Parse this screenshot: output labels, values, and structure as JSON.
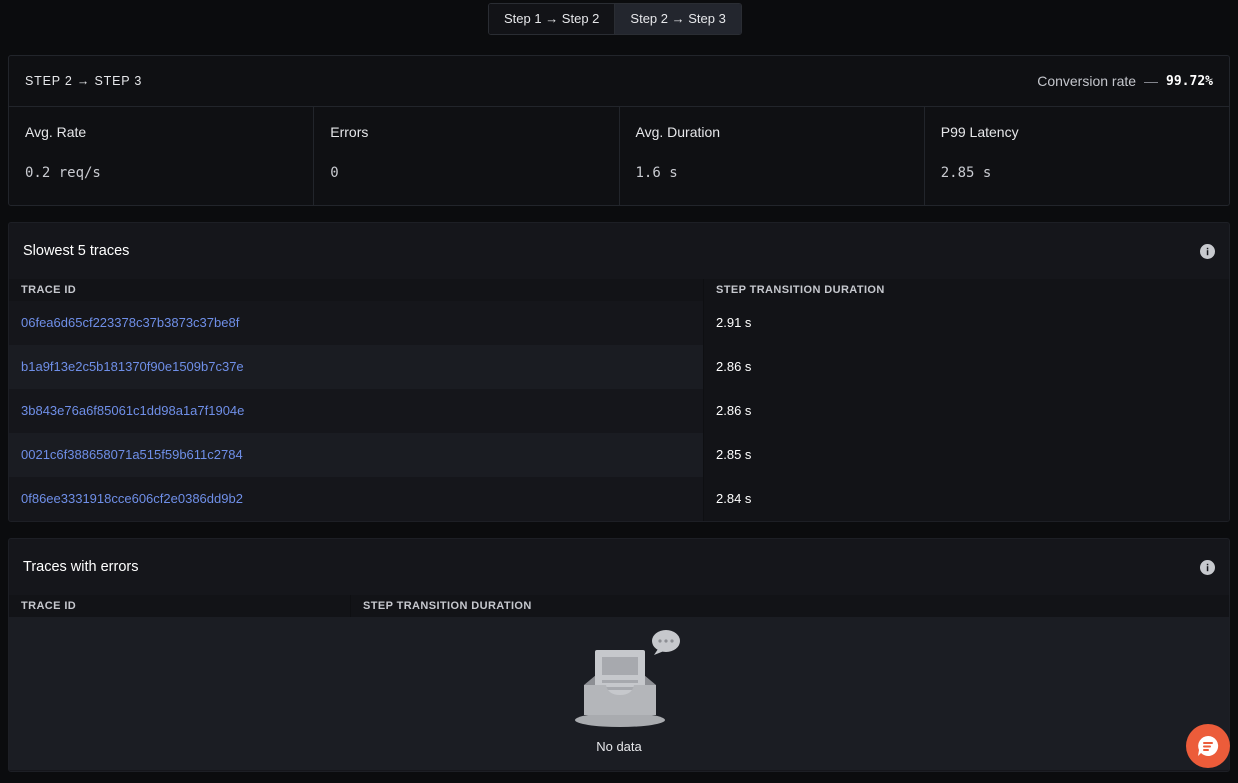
{
  "tabs": [
    {
      "label": "Step 1 → Step 2",
      "active": false
    },
    {
      "label": "Step 2 → Step 3",
      "active": true
    }
  ],
  "summary": {
    "title": "STEP 2 → STEP 3",
    "conversion_label": "Conversion rate",
    "conversion_dash": "—",
    "conversion_value": "99.72%",
    "metrics": [
      {
        "label": "Avg. Rate",
        "value": "0.2 req/s"
      },
      {
        "label": "Errors",
        "value": "0"
      },
      {
        "label": "Avg. Duration",
        "value": "1.6 s"
      },
      {
        "label": "P99 Latency",
        "value": "2.85 s"
      }
    ]
  },
  "slowest": {
    "title": "Slowest 5 traces",
    "col_trace": "TRACE ID",
    "col_duration": "STEP TRANSITION DURATION",
    "rows": [
      {
        "trace_id": "06fea6d65cf223378c37b3873c37be8f",
        "duration": "2.91 s"
      },
      {
        "trace_id": "b1a9f13e2c5b181370f90e1509b7c37e",
        "duration": "2.86 s"
      },
      {
        "trace_id": "3b843e76a6f85061c1dd98a1a7f1904e",
        "duration": "2.86 s"
      },
      {
        "trace_id": "0021c6f388658071a515f59b611c2784",
        "duration": "2.85 s"
      },
      {
        "trace_id": "0f86ee3331918cce606cf2e0386dd9b2",
        "duration": "2.84 s"
      }
    ]
  },
  "errors": {
    "title": "Traces with errors",
    "col_trace": "TRACE ID",
    "col_duration": "STEP TRANSITION DURATION",
    "empty_text": "No data"
  },
  "colors": {
    "accent_link": "#6f8fe8",
    "fab": "#ec5c3a"
  }
}
